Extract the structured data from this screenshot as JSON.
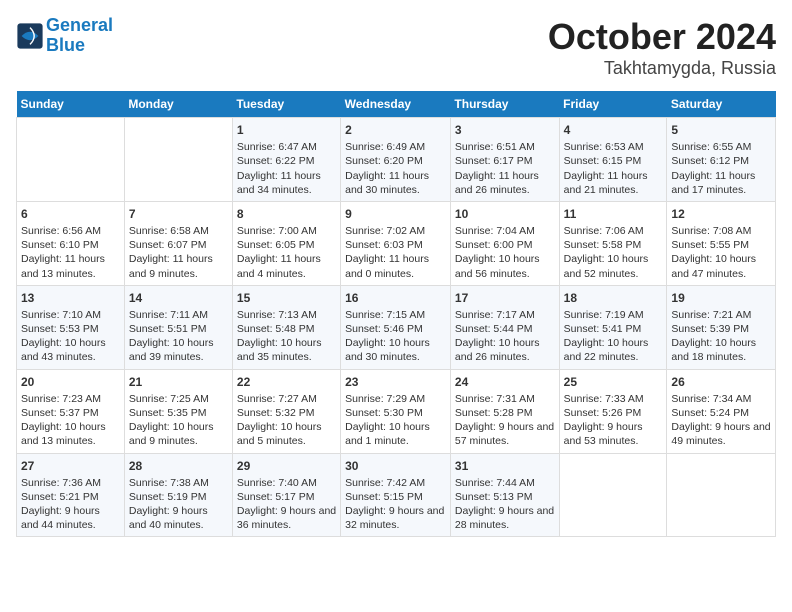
{
  "logo": {
    "line1": "General",
    "line2": "Blue"
  },
  "title": "October 2024",
  "subtitle": "Takhtamygda, Russia",
  "header": {
    "days": [
      "Sunday",
      "Monday",
      "Tuesday",
      "Wednesday",
      "Thursday",
      "Friday",
      "Saturday"
    ]
  },
  "weeks": [
    {
      "cells": [
        {
          "day": null,
          "content": ""
        },
        {
          "day": null,
          "content": ""
        },
        {
          "day": "1",
          "sunrise": "6:47 AM",
          "sunset": "6:22 PM",
          "daylight": "11 hours and 34 minutes."
        },
        {
          "day": "2",
          "sunrise": "6:49 AM",
          "sunset": "6:20 PM",
          "daylight": "11 hours and 30 minutes."
        },
        {
          "day": "3",
          "sunrise": "6:51 AM",
          "sunset": "6:17 PM",
          "daylight": "11 hours and 26 minutes."
        },
        {
          "day": "4",
          "sunrise": "6:53 AM",
          "sunset": "6:15 PM",
          "daylight": "11 hours and 21 minutes."
        },
        {
          "day": "5",
          "sunrise": "6:55 AM",
          "sunset": "6:12 PM",
          "daylight": "11 hours and 17 minutes."
        }
      ]
    },
    {
      "cells": [
        {
          "day": "6",
          "sunrise": "6:56 AM",
          "sunset": "6:10 PM",
          "daylight": "11 hours and 13 minutes."
        },
        {
          "day": "7",
          "sunrise": "6:58 AM",
          "sunset": "6:07 PM",
          "daylight": "11 hours and 9 minutes."
        },
        {
          "day": "8",
          "sunrise": "7:00 AM",
          "sunset": "6:05 PM",
          "daylight": "11 hours and 4 minutes."
        },
        {
          "day": "9",
          "sunrise": "7:02 AM",
          "sunset": "6:03 PM",
          "daylight": "11 hours and 0 minutes."
        },
        {
          "day": "10",
          "sunrise": "7:04 AM",
          "sunset": "6:00 PM",
          "daylight": "10 hours and 56 minutes."
        },
        {
          "day": "11",
          "sunrise": "7:06 AM",
          "sunset": "5:58 PM",
          "daylight": "10 hours and 52 minutes."
        },
        {
          "day": "12",
          "sunrise": "7:08 AM",
          "sunset": "5:55 PM",
          "daylight": "10 hours and 47 minutes."
        }
      ]
    },
    {
      "cells": [
        {
          "day": "13",
          "sunrise": "7:10 AM",
          "sunset": "5:53 PM",
          "daylight": "10 hours and 43 minutes."
        },
        {
          "day": "14",
          "sunrise": "7:11 AM",
          "sunset": "5:51 PM",
          "daylight": "10 hours and 39 minutes."
        },
        {
          "day": "15",
          "sunrise": "7:13 AM",
          "sunset": "5:48 PM",
          "daylight": "10 hours and 35 minutes."
        },
        {
          "day": "16",
          "sunrise": "7:15 AM",
          "sunset": "5:46 PM",
          "daylight": "10 hours and 30 minutes."
        },
        {
          "day": "17",
          "sunrise": "7:17 AM",
          "sunset": "5:44 PM",
          "daylight": "10 hours and 26 minutes."
        },
        {
          "day": "18",
          "sunrise": "7:19 AM",
          "sunset": "5:41 PM",
          "daylight": "10 hours and 22 minutes."
        },
        {
          "day": "19",
          "sunrise": "7:21 AM",
          "sunset": "5:39 PM",
          "daylight": "10 hours and 18 minutes."
        }
      ]
    },
    {
      "cells": [
        {
          "day": "20",
          "sunrise": "7:23 AM",
          "sunset": "5:37 PM",
          "daylight": "10 hours and 13 minutes."
        },
        {
          "day": "21",
          "sunrise": "7:25 AM",
          "sunset": "5:35 PM",
          "daylight": "10 hours and 9 minutes."
        },
        {
          "day": "22",
          "sunrise": "7:27 AM",
          "sunset": "5:32 PM",
          "daylight": "10 hours and 5 minutes."
        },
        {
          "day": "23",
          "sunrise": "7:29 AM",
          "sunset": "5:30 PM",
          "daylight": "10 hours and 1 minute."
        },
        {
          "day": "24",
          "sunrise": "7:31 AM",
          "sunset": "5:28 PM",
          "daylight": "9 hours and 57 minutes."
        },
        {
          "day": "25",
          "sunrise": "7:33 AM",
          "sunset": "5:26 PM",
          "daylight": "9 hours and 53 minutes."
        },
        {
          "day": "26",
          "sunrise": "7:34 AM",
          "sunset": "5:24 PM",
          "daylight": "9 hours and 49 minutes."
        }
      ]
    },
    {
      "cells": [
        {
          "day": "27",
          "sunrise": "7:36 AM",
          "sunset": "5:21 PM",
          "daylight": "9 hours and 44 minutes."
        },
        {
          "day": "28",
          "sunrise": "7:38 AM",
          "sunset": "5:19 PM",
          "daylight": "9 hours and 40 minutes."
        },
        {
          "day": "29",
          "sunrise": "7:40 AM",
          "sunset": "5:17 PM",
          "daylight": "9 hours and 36 minutes."
        },
        {
          "day": "30",
          "sunrise": "7:42 AM",
          "sunset": "5:15 PM",
          "daylight": "9 hours and 32 minutes."
        },
        {
          "day": "31",
          "sunrise": "7:44 AM",
          "sunset": "5:13 PM",
          "daylight": "9 hours and 28 minutes."
        },
        {
          "day": null,
          "content": ""
        },
        {
          "day": null,
          "content": ""
        }
      ]
    }
  ]
}
